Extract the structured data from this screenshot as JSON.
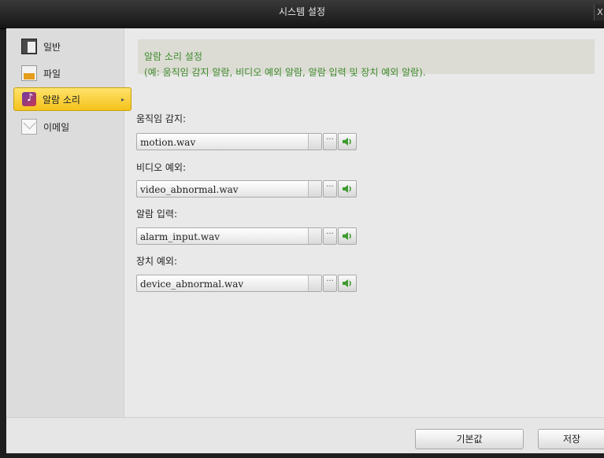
{
  "window": {
    "title": "시스템 설정",
    "close_label": "X"
  },
  "sidebar": {
    "items": [
      {
        "label": "일반",
        "icon": "general-settings-icon"
      },
      {
        "label": "파일",
        "icon": "file-icon"
      },
      {
        "label": "알람 소리",
        "icon": "music-note-icon",
        "active": true
      },
      {
        "label": "이메일",
        "icon": "envelope-icon"
      }
    ]
  },
  "main": {
    "info_title": "알람 소리 설정",
    "info_desc": "(예: 움직임 감지 알람, 비디오 예외 알람, 알람 입력 및 장치 예외 알람).",
    "fields": [
      {
        "label": "움직임 감지:",
        "value": "motion.wav"
      },
      {
        "label": "비디오 예외:",
        "value": "video_abnormal.wav"
      },
      {
        "label": "알람 입력:",
        "value": "alarm_input.wav"
      },
      {
        "label": "장치 예외:",
        "value": "device_abnormal.wav"
      }
    ],
    "browse_label": "···"
  },
  "footer": {
    "default_label": "기본값",
    "save_label": "저장"
  },
  "colors": {
    "accent": "#f4c21b",
    "info_text": "#3f8a2e"
  }
}
